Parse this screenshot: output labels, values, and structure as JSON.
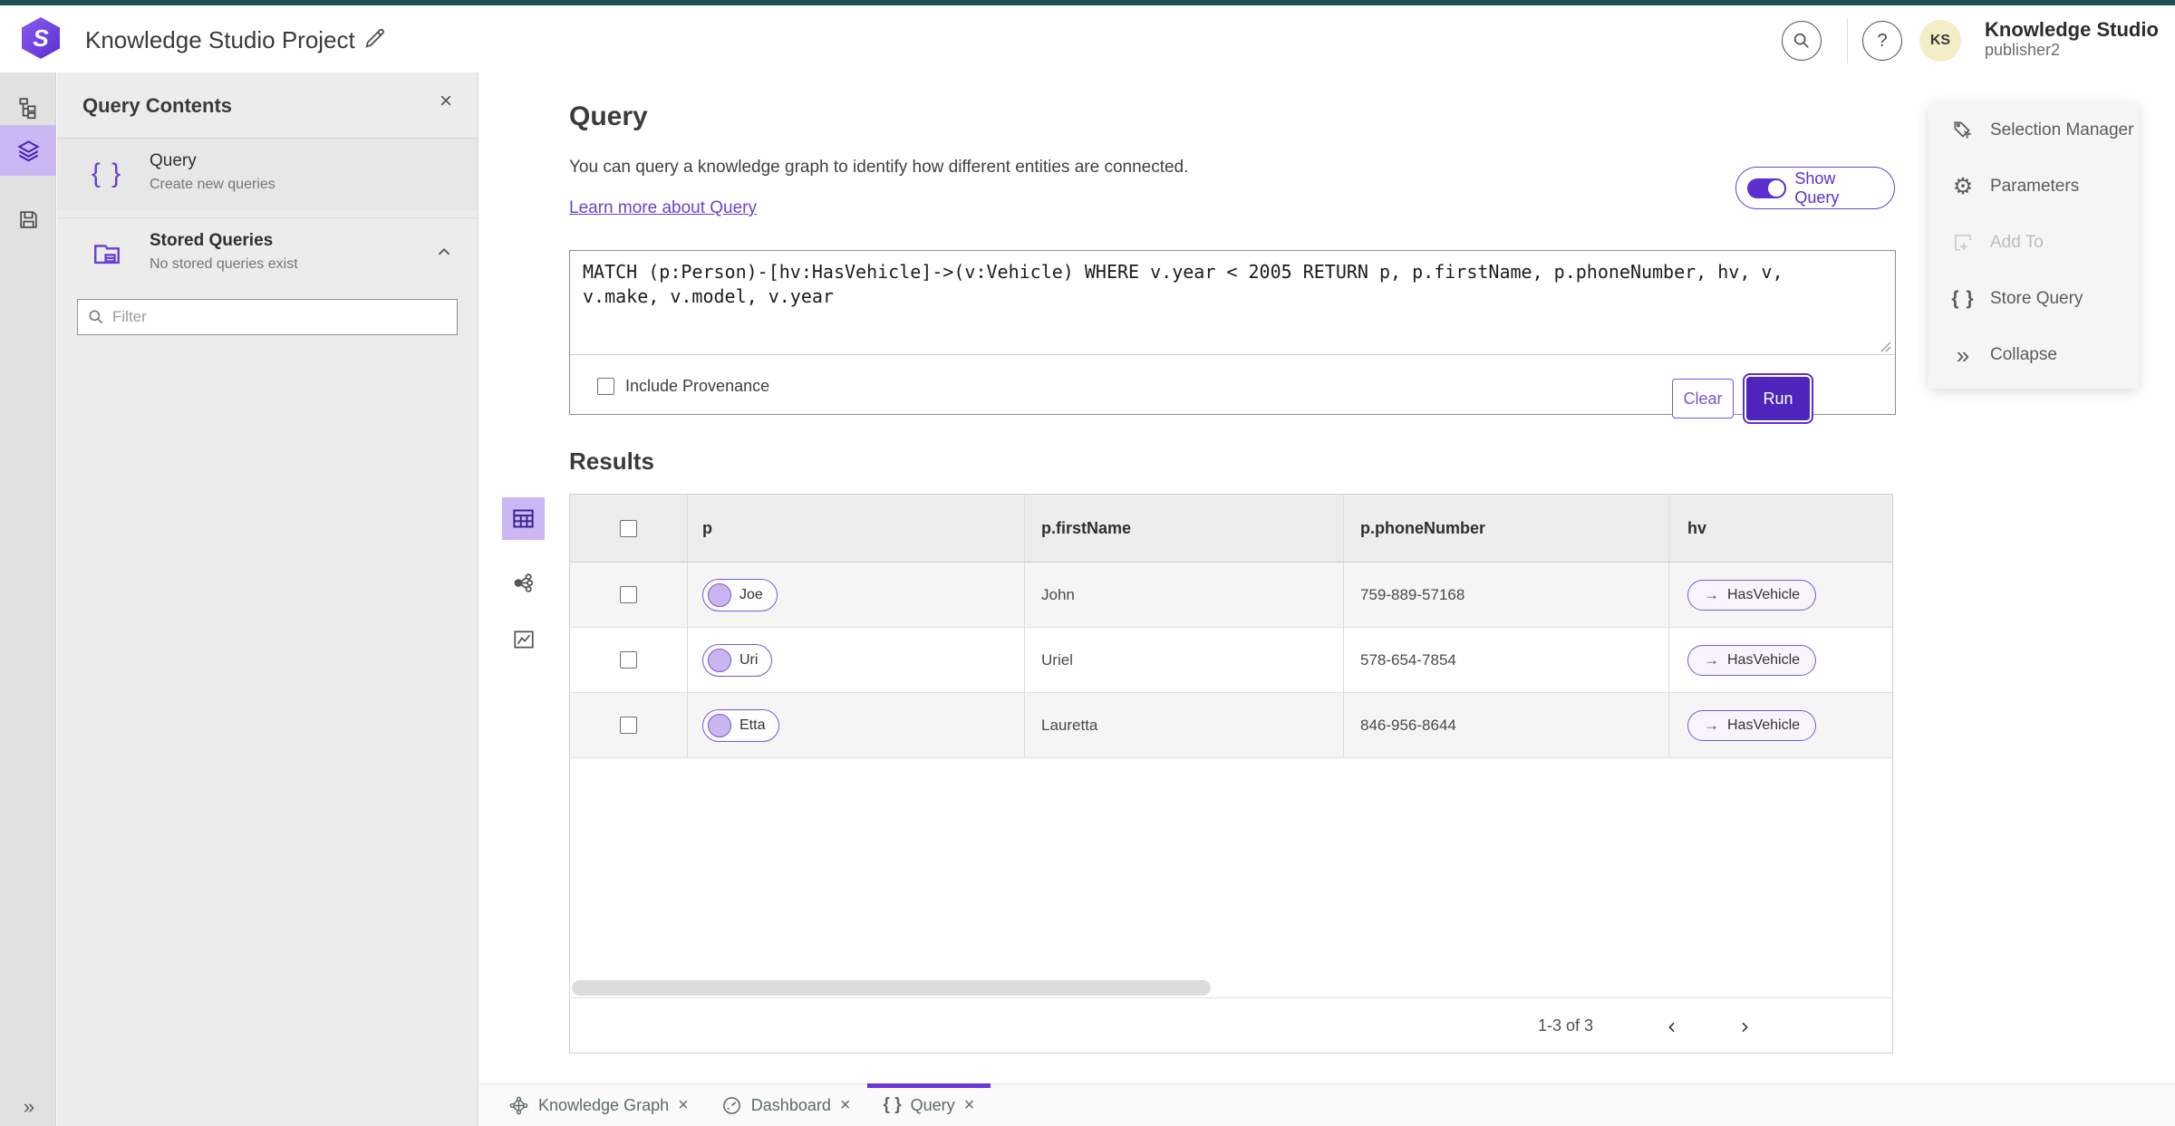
{
  "header": {
    "title": "Knowledge Studio Project",
    "brand_line1": "Knowledge Studio",
    "brand_line2": "publisher2",
    "avatar": "KS"
  },
  "icons": {
    "close": "×",
    "braces": "{ }",
    "gear": "⚙",
    "collapse_double": "»",
    "expand_double": "»",
    "arrow_right": "→",
    "help": "?"
  },
  "left_panel": {
    "title": "Query Contents",
    "query_item": {
      "title": "Query",
      "subtitle": "Create new queries"
    },
    "stored_item": {
      "title": "Stored Queries",
      "subtitle": "No stored queries exist"
    },
    "filter_placeholder": "Filter"
  },
  "query": {
    "heading": "Query",
    "description": "You can query a knowledge graph to identify how different entities are connected.",
    "link": "Learn more about Query",
    "show_query_label": "Show Query",
    "query_text": "MATCH (p:Person)-[hv:HasVehicle]->(v:Vehicle) WHERE v.year < 2005 RETURN p, p.firstName, p.phoneNumber, hv, v, v.make, v.model, v.year",
    "include_provenance_label": "Include Provenance",
    "clear_label": "Clear",
    "run_label": "Run"
  },
  "results": {
    "heading": "Results",
    "columns": [
      "p",
      "p.firstName",
      "p.phoneNumber",
      "hv"
    ],
    "rows": [
      {
        "p": "Joe",
        "firstName": "John",
        "phoneNumber": "759-889-57168",
        "hv": "HasVehicle"
      },
      {
        "p": "Uri",
        "firstName": "Uriel",
        "phoneNumber": "578-654-7854",
        "hv": "HasVehicle"
      },
      {
        "p": "Etta",
        "firstName": "Lauretta",
        "phoneNumber": "846-956-8644",
        "hv": "HasVehicle"
      }
    ],
    "pagination": "1-3 of 3"
  },
  "right_menu": {
    "items": [
      {
        "label": "Selection Manager",
        "disabled": false
      },
      {
        "label": "Parameters",
        "disabled": false
      },
      {
        "label": "Add To",
        "disabled": true
      },
      {
        "label": "Store Query",
        "disabled": false
      },
      {
        "label": "Collapse",
        "disabled": false
      }
    ]
  },
  "tabs": [
    {
      "label": "Knowledge Graph",
      "active": false
    },
    {
      "label": "Dashboard",
      "active": false
    },
    {
      "label": "Query",
      "active": true
    }
  ],
  "colors": {
    "primary_purple": "#4d25bd",
    "accent_purple": "#6a42cf",
    "light_purple_highlight": "#cbb7f3",
    "teal_strip": "#1d5152",
    "avatar_bg": "#f3eec8"
  }
}
